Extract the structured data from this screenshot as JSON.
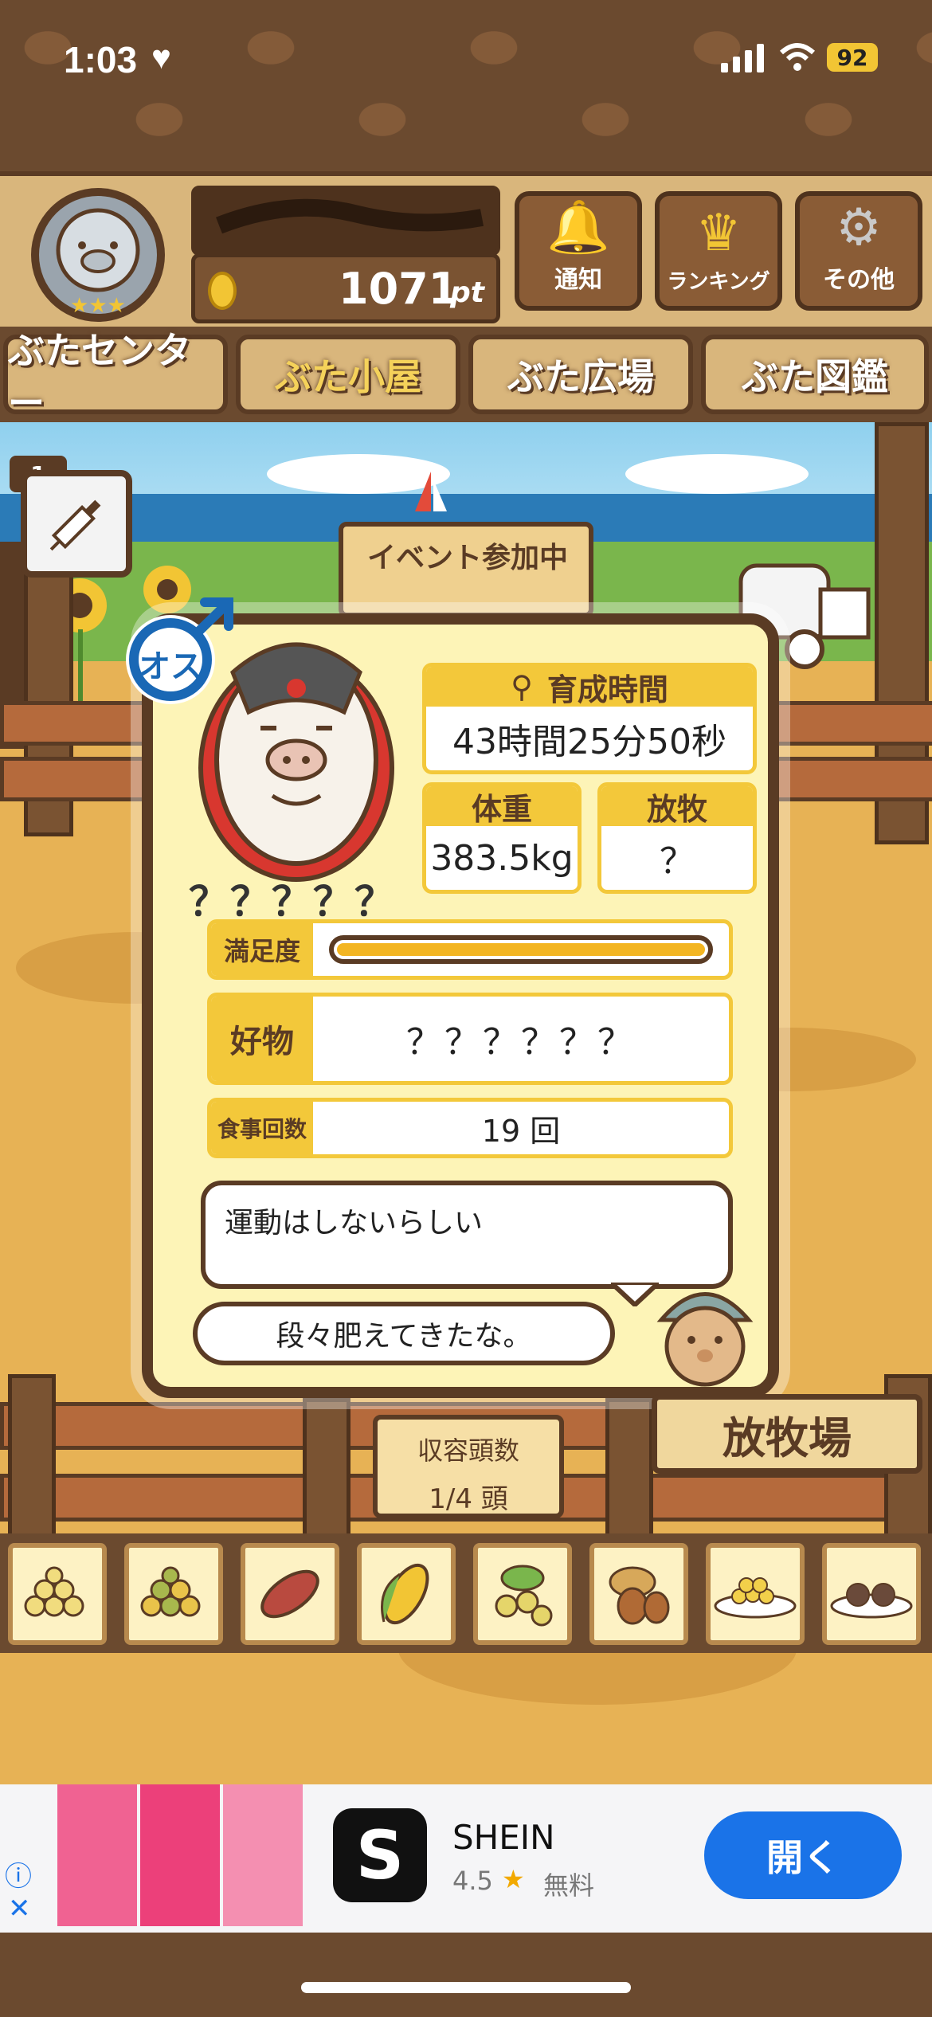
{
  "status_bar": {
    "time": "1:03",
    "heart": "♥",
    "battery": "92"
  },
  "header": {
    "points_value": "1071",
    "points_unit": "pt",
    "buttons": [
      {
        "label": "通知",
        "icon": "bell-icon"
      },
      {
        "label": "ランキング",
        "icon": "crown-icon"
      },
      {
        "label": "その他",
        "icon": "gear-icon"
      }
    ]
  },
  "nav_tabs": [
    "ぶたセンター",
    "ぶた小屋",
    "ぶた広場",
    "ぶた図鑑"
  ],
  "item_badge_count": "1",
  "event_sign": "イベント参加中",
  "gender_badge": "オス",
  "pig": {
    "name": "？？？？？",
    "raising_time_label": "育成時間",
    "raising_time": "43時間25分50秒",
    "weight_label": "体重",
    "weight": "383.5kg",
    "grazing_label": "放牧",
    "grazing": "？",
    "satisfaction_label": "満足度",
    "satisfaction_fraction": 1.0,
    "favorite_label": "好物",
    "favorite": "？？？？？？",
    "meals_label": "食事回数",
    "meals": "19 回",
    "comment": "運動はしないらしい",
    "farmer_comment": "段々肥えてきたな。"
  },
  "capacity": {
    "label": "収容頭数",
    "value": "1/4 頭"
  },
  "pasture_sign": "放牧場",
  "foods": [
    "grains-icon",
    "mixed-grains-icon",
    "sweet-potato-icon",
    "corn-icon",
    "berries-icon",
    "acorn-icon",
    "bean-plate-icon",
    "meatball-plate-icon"
  ],
  "ad": {
    "app_name": "SHEIN",
    "app_icon_letter": "S",
    "rating": "4.5",
    "star": "★",
    "price": "無料",
    "open_button": "開く",
    "info": "ⓘ",
    "close": "✕"
  },
  "colors": {
    "wood_dark": "#5a3b24",
    "yellow": "#f3c83a",
    "card": "#fdf4b7",
    "ad_blue": "#1a73e8"
  }
}
